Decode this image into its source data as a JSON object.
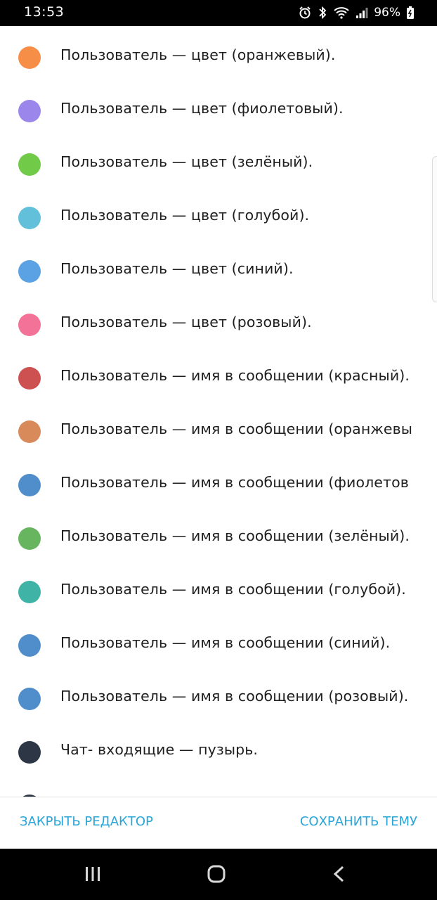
{
  "status_bar": {
    "time": "13:53",
    "battery_percent": "96%"
  },
  "items": [
    {
      "label": "Пользователь — цвет (оранжевый).",
      "color": "#F78E47"
    },
    {
      "label": "Пользователь — цвет (фиолетовый).",
      "color": "#9B86EC"
    },
    {
      "label": "Пользователь — цвет (зелёный).",
      "color": "#72CA49"
    },
    {
      "label": "Пользователь — цвет (голубой).",
      "color": "#62C0DA"
    },
    {
      "label": "Пользователь — цвет (синий).",
      "color": "#5AA2E3"
    },
    {
      "label": "Пользователь — цвет (розовый).",
      "color": "#F27397"
    },
    {
      "label": "Пользователь — имя в сообщении (красный).",
      "color": "#CC5150"
    },
    {
      "label": "Пользователь — имя в сообщении (оранжевы",
      "color": "#D98A5A"
    },
    {
      "label": "Пользователь — имя в сообщении (фиолетов",
      "color": "#4F8ECB"
    },
    {
      "label": "Пользователь — имя в сообщении (зелёный).",
      "color": "#67B55E"
    },
    {
      "label": "Пользователь — имя в сообщении (голубой).",
      "color": "#3FB3A6"
    },
    {
      "label": "Пользователь — имя в сообщении (синий).",
      "color": "#4F8ECB"
    },
    {
      "label": "Пользователь — имя в сообщении (розовый).",
      "color": "#4F8ECB"
    },
    {
      "label": "Чат- входящие — пузырь.",
      "color": "#2C3645"
    }
  ],
  "partial_item_color": "#2C3645",
  "actions": {
    "close_label": "ЗАКРЫТЬ РЕДАКТОР",
    "save_label": "СОХРАНИТЬ ТЕМУ",
    "accent_color": "#2AA5D8"
  },
  "nav": {
    "recents_icon": "recents-icon",
    "home_icon": "home-icon",
    "back_icon": "back-icon"
  }
}
